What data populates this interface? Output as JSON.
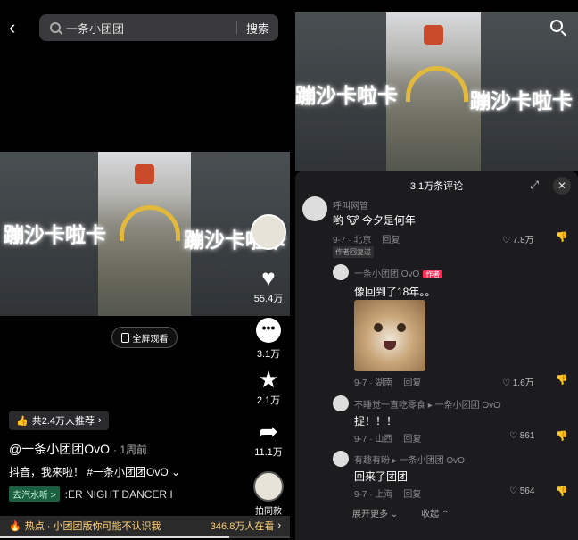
{
  "left": {
    "search": {
      "value": "一条小团团",
      "button": "搜索"
    },
    "video_caption_left": "蹦沙卡啦卡",
    "video_caption_right": "蹦沙卡啦卡",
    "actions": {
      "likes": "55.4万",
      "comments": "3.1万",
      "favorites": "2.1万",
      "shares": "11.1万"
    },
    "fullscreen_label": "全屏观看",
    "recommend": "共2.4万人推荐",
    "author": "@一条小团团OvO",
    "time": "· 1周前",
    "desc": "抖音，我来啦！ #一条小团团OvO ⌄",
    "music_tag": "去汽水听 >",
    "music_song": ":ER  NIGHT DANCER  I",
    "shoot_label": "拍同款",
    "hot_text": "热点 · 小团团版你可能不认识我",
    "hot_count": "346.8万人在看",
    "progress": 0.79
  },
  "right": {
    "sheet_title": "3.1万条评论",
    "comments": [
      {
        "name": "呼叫网管",
        "text": "哟 🐮 今夕是何年",
        "meta": "9-7 · 北京",
        "reply": "回复",
        "likes": "7.8万",
        "tag": "作者回复过"
      },
      {
        "name": "一条小团团 OvO",
        "badge": "作者",
        "text": "像回到了18年。。",
        "meta": "9-7 · 湖南",
        "reply": "回复",
        "likes": "1.6万"
      },
      {
        "name": "不睡觉一直吃零食 ▸ 一条小团团 OvO",
        "text": "捉！！！",
        "meta": "9-7 · 山西",
        "reply": "回复",
        "likes": "861"
      },
      {
        "name": "有趣有盼 ▸ 一条小团团 OvO",
        "text": "回来了团团",
        "meta": "9-7 · 上海",
        "reply": "回复",
        "likes": "564"
      }
    ],
    "expand_more": "展开更多 ⌄",
    "collapse": "收起 ⌃"
  }
}
